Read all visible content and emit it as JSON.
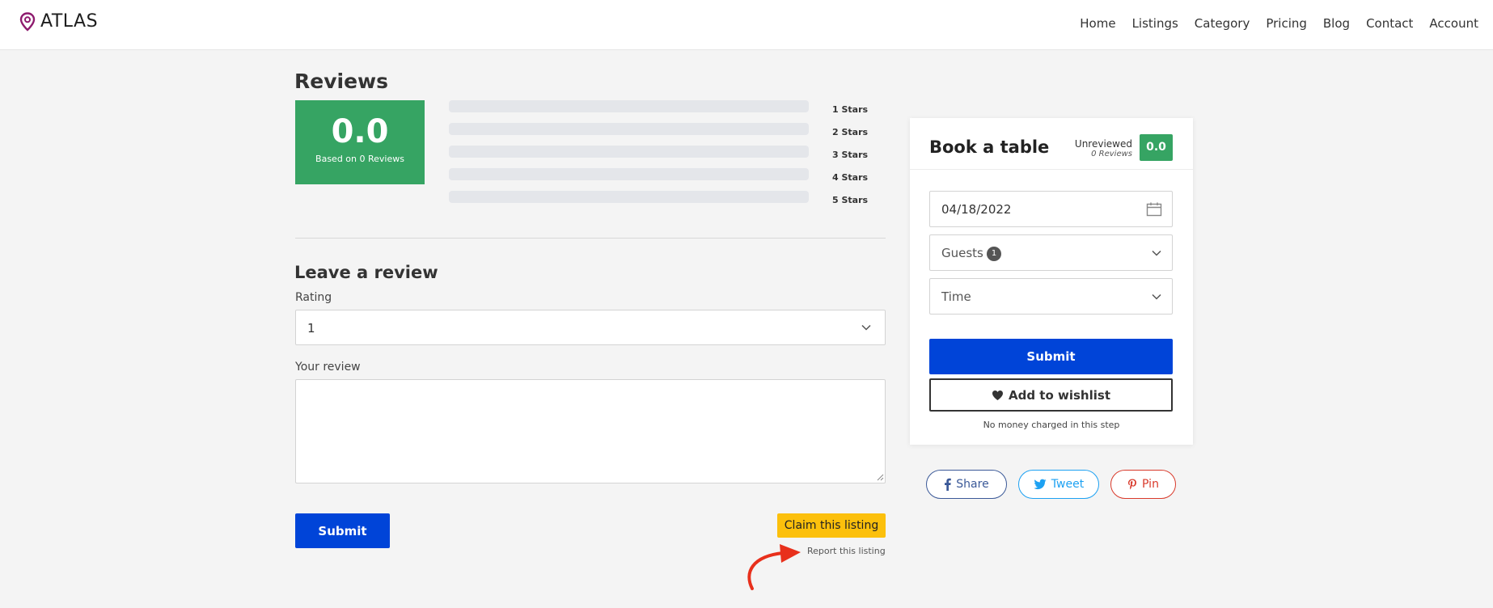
{
  "header": {
    "brand": "ATLAS",
    "nav": [
      "Home",
      "Listings",
      "Category",
      "Pricing",
      "Blog",
      "Contact",
      "Account"
    ]
  },
  "reviews": {
    "title": "Reviews",
    "score": "0.0",
    "based_on": "Based on 0 Reviews",
    "bars": [
      {
        "label": "1 Stars",
        "fraction": 0
      },
      {
        "label": "2 Stars",
        "fraction": 0
      },
      {
        "label": "3 Stars",
        "fraction": 0
      },
      {
        "label": "4 Stars",
        "fraction": 0
      },
      {
        "label": "5 Stars",
        "fraction": 0
      }
    ]
  },
  "leave_review": {
    "title": "Leave a review",
    "rating_label": "Rating",
    "rating_value": "1",
    "review_label": "Your review",
    "review_value": "",
    "submit": "Submit"
  },
  "listing_actions": {
    "claim": "Claim this listing",
    "report": "Report this listing"
  },
  "booking": {
    "title": "Book a table",
    "status": "Unreviewed",
    "reviews_count": "0 Reviews",
    "score": "0.0",
    "date": "04/18/2022",
    "guests_label": "Guests",
    "guests_count": "1",
    "time_placeholder": "Time",
    "submit": "Submit",
    "wishlist": "Add to wishlist",
    "note": "No money charged in this step"
  },
  "share": {
    "facebook": "Share",
    "twitter": "Tweet",
    "pinterest": "Pin"
  },
  "colors": {
    "accent_green": "#36a463",
    "primary_blue": "#0044d8",
    "claim_yellow": "#fcc00c",
    "arrow_red": "#e8301c",
    "logo_purple": "#8e1b6e"
  }
}
